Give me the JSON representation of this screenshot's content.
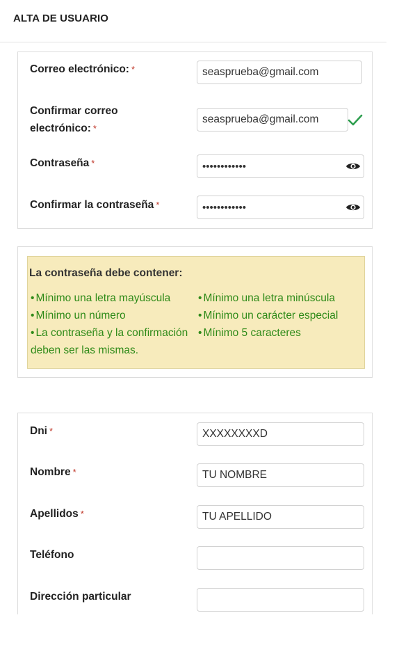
{
  "header": {
    "title": "ALTA DE USUARIO"
  },
  "account": {
    "email_label": "Correo electrónico:",
    "email_value": "seasprueba@gmail.com",
    "confirm_email_label_line1": "Confirmar correo",
    "confirm_email_label_line2": "electrónico:",
    "confirm_email_value": "seasprueba@gmail.com",
    "password_label": "Contraseña",
    "password_value": "••••••••••••",
    "confirm_password_label": "Confirmar la contraseña",
    "confirm_password_value": "••••••••••••",
    "required_mark": "*"
  },
  "password_rules": {
    "title": "La contraseña debe contener:",
    "bullet": "•",
    "rules": [
      "Mínimo una letra mayúscula",
      "Mínimo una letra minúscula",
      "Mínimo un número",
      "Mínimo un carácter especial",
      "La contraseña y la confirmación",
      "Mínimo 5 caracteres"
    ],
    "rule_continuation": "deben ser las mismas."
  },
  "personal": {
    "dni_label": "Dni",
    "dni_placeholder": "XXXXXXXXD",
    "name_label": "Nombre",
    "name_placeholder": "TU NOMBRE",
    "surname_label": "Apellidos",
    "surname_placeholder": "TU APELLIDO",
    "phone_label": "Teléfono",
    "phone_value": "",
    "address_label": "Dirección particular",
    "address_value": ""
  },
  "colors": {
    "rules_background": "#f7ebbc",
    "rules_text": "#2e8a18",
    "required_mark": "#c0392b",
    "check": "#2e9e4f"
  },
  "icons": [
    "eye-icon",
    "check-icon"
  ]
}
